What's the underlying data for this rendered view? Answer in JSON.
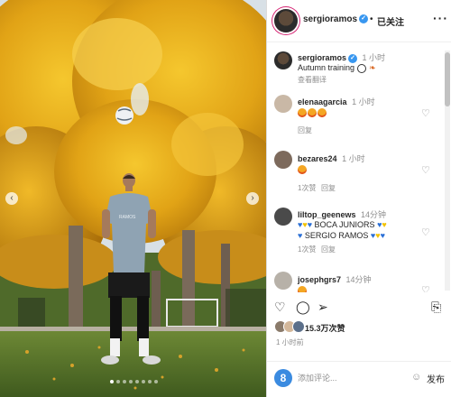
{
  "header": {
    "username": "sergioramos",
    "separator": "•",
    "follow_status": "已关注",
    "more_label": "···"
  },
  "media": {
    "prev_label": "‹",
    "next_label": "›",
    "dots_count": 8
  },
  "caption": {
    "username": "sergioramos",
    "time": "1 小时",
    "text": "Autumn training",
    "translate_label": "查看翻译"
  },
  "comments": [
    {
      "username": "elenaagarcia",
      "time": "1 小时",
      "text": "",
      "reply_label": "回复"
    },
    {
      "username": "bezares24",
      "time": "1 小时",
      "text": "",
      "likes": "1次赞",
      "reply_label": "回复"
    },
    {
      "username": "liltop_geenews",
      "time": "14分钟",
      "line1": "BOCA JUNIORS",
      "line2": "SERGIO RAMOS",
      "likes": "1次赞",
      "reply_label": "回复"
    },
    {
      "username": "josephgrs7",
      "time": "14分钟"
    }
  ],
  "actions": {
    "like_icon": "heart-icon",
    "comment_icon": "comment-icon",
    "share_icon": "share-icon",
    "save_icon": "bookmark-icon"
  },
  "likes": {
    "count_text": "15.3万次赞"
  },
  "posted_time": "1 小时前",
  "composer": {
    "placeholder": "添加评论...",
    "post_label": "发布"
  },
  "colors": {
    "verified": "#3897f0",
    "foliage": "#e3a514",
    "grass": "#5d7a2e",
    "user_avatar": "#3b8be0"
  }
}
